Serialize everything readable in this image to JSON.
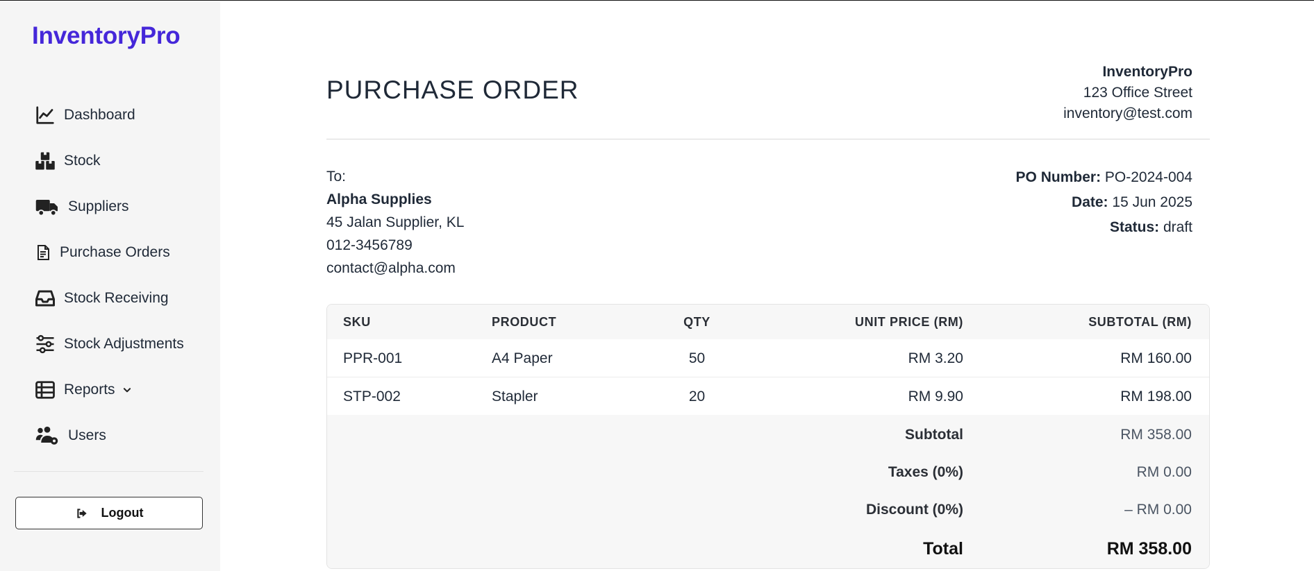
{
  "sidebar": {
    "brand": "InventoryPro",
    "items": [
      {
        "label": "Dashboard",
        "icon": "chart-line-icon"
      },
      {
        "label": "Stock",
        "icon": "boxes-icon"
      },
      {
        "label": "Suppliers",
        "icon": "truck-icon"
      },
      {
        "label": "Purchase Orders",
        "icon": "file-invoice-icon"
      },
      {
        "label": "Stock Receiving",
        "icon": "inbox-icon"
      },
      {
        "label": "Stock Adjustments",
        "icon": "sliders-icon"
      },
      {
        "label": "Reports",
        "icon": "table-icon"
      },
      {
        "label": "Users",
        "icon": "users-gear-icon"
      }
    ],
    "logout_label": "Logout"
  },
  "po": {
    "title": "PURCHASE ORDER",
    "company": {
      "name": "InventoryPro",
      "address": "123 Office Street",
      "email": "inventory@test.com"
    },
    "to": {
      "label": "To:",
      "name": "Alpha Supplies",
      "address": "45 Jalan Supplier, KL",
      "phone": "012-3456789",
      "email": "contact@alpha.com"
    },
    "meta": {
      "po_number_label": "PO Number:",
      "po_number": "PO-2024-004",
      "date_label": "Date:",
      "date": "15 Jun 2025",
      "status_label": "Status:",
      "status": "draft"
    },
    "table": {
      "headers": {
        "sku": "SKU",
        "product": "PRODUCT",
        "qty": "QTY",
        "unit_price": "UNIT PRICE (RM)",
        "subtotal": "SUBTOTAL (RM)"
      },
      "rows": [
        {
          "sku": "PPR-001",
          "product": "A4 Paper",
          "qty": "50",
          "unit_price": "RM 3.20",
          "subtotal": "RM 160.00"
        },
        {
          "sku": "STP-002",
          "product": "Stapler",
          "qty": "20",
          "unit_price": "RM 9.90",
          "subtotal": "RM 198.00"
        }
      ]
    },
    "totals": {
      "subtotal_label": "Subtotal",
      "subtotal": "RM 358.00",
      "taxes_label": "Taxes (0%)",
      "taxes": "RM 0.00",
      "discount_label": "Discount (0%)",
      "discount": "– RM 0.00",
      "total_label": "Total",
      "total": "RM 358.00"
    }
  }
}
